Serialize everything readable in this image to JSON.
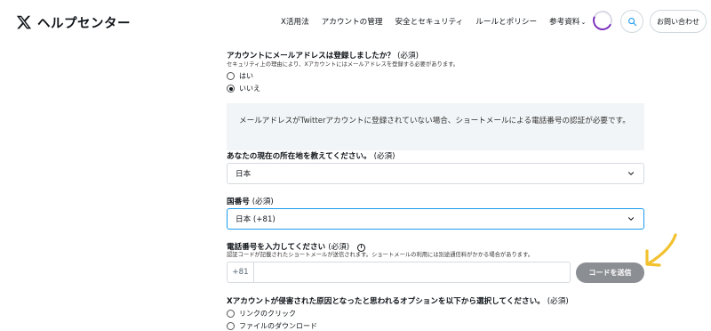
{
  "header": {
    "logo_text": "ヘルプセンター",
    "nav": [
      {
        "label": "X活用法"
      },
      {
        "label": "アカウントの管理"
      },
      {
        "label": "安全とセキュリティ"
      },
      {
        "label": "ルールとポリシー"
      },
      {
        "label": "参考資料",
        "has_dropdown": true
      }
    ],
    "contact_label": "お問い合わせ",
    "icons": {
      "search": "search-icon",
      "loading": "loading-spinner-icon",
      "logo": "x-logo-icon"
    }
  },
  "form": {
    "email_question": {
      "label": "アカウントにメールアドレスは登録しましたか？",
      "required": "(必須)",
      "help": "セキュリティ上の理由により、Xアカウントにはメールアドレスを登録する必要があります。",
      "options": [
        "はい",
        "いいえ"
      ],
      "selected": "いいえ"
    },
    "notice": "メールアドレスがTwitterアカウントに登録されていない場合、ショートメールによる電話番号の認証が必要です。",
    "location": {
      "label": "あなたの現在の所在地を教えてください。",
      "required": "(必須)",
      "value": "日本"
    },
    "country_code": {
      "label": "国番号",
      "required": "(必須)",
      "value": "日本 (+81)"
    },
    "phone": {
      "label": "電話番号を入力してください",
      "required": "(必須)",
      "help": "認証コードが記載されたショートメールが送信されます。ショートメールの利用には別途通信料がかかる場合があります。",
      "prefix": "+81",
      "value": "",
      "send_label": "コードを送信"
    },
    "compromise_question": {
      "label": "Xアカウントが侵害された原因となったと思われるオプションを以下から選択してください。",
      "required": "(必須)",
      "options": [
        "リンクのクリック",
        "ファイルのダウンロード"
      ]
    }
  },
  "colors": {
    "accent": "#1d9bf0",
    "annotation_arrow": "#f2c12e",
    "send_button": "#8b8e92"
  }
}
